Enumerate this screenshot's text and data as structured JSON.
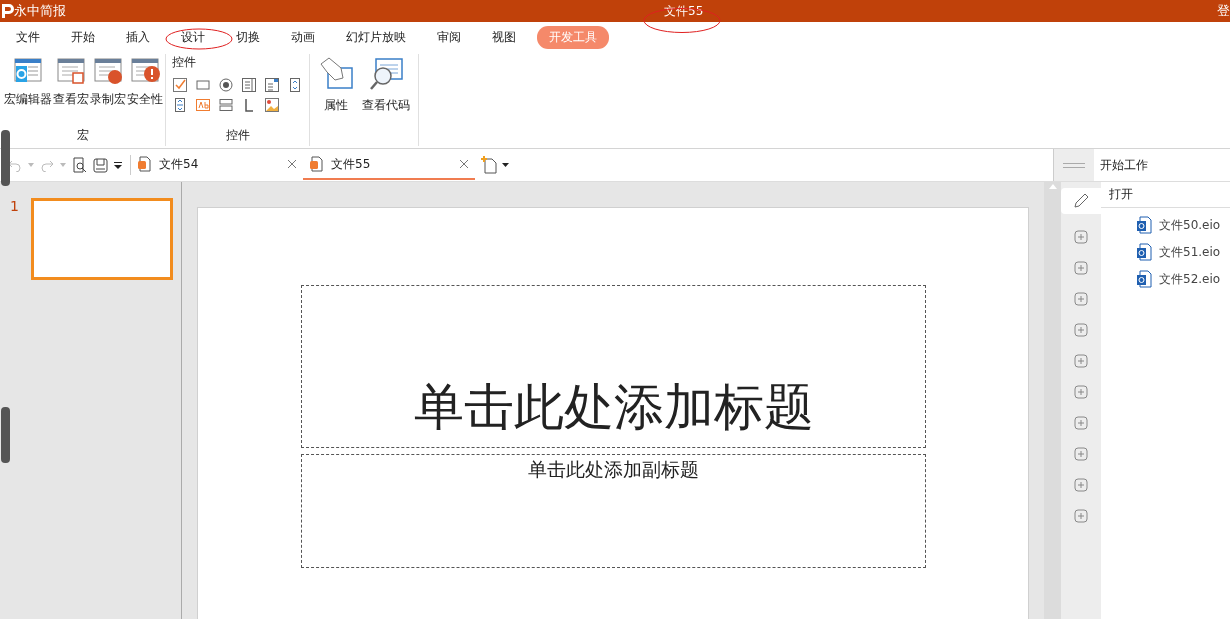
{
  "window": {
    "app_name": "永中简报",
    "title": "文件55",
    "account": "登"
  },
  "menu_tabs": [
    {
      "label": "文件",
      "selected": false
    },
    {
      "label": "开始",
      "selected": false
    },
    {
      "label": "插入",
      "selected": false
    },
    {
      "label": "设计",
      "selected": false
    },
    {
      "label": "切换",
      "selected": false
    },
    {
      "label": "动画",
      "selected": false
    },
    {
      "label": "幻灯片放映",
      "selected": false
    },
    {
      "label": "审阅",
      "selected": false
    },
    {
      "label": "视图",
      "selected": false
    },
    {
      "label": "开发工具",
      "selected": true
    }
  ],
  "ribbon": {
    "macro_group": {
      "label": "宏",
      "buttons": [
        {
          "label": "宏编辑器",
          "kind": "editor"
        },
        {
          "label": "查看宏",
          "kind": "view"
        },
        {
          "label": "录制宏",
          "kind": "record"
        },
        {
          "label": "安全性",
          "kind": "security"
        }
      ]
    },
    "controls_group": {
      "title": "控件",
      "label": "控件"
    },
    "code_group": {
      "buttons": [
        {
          "label": "属性",
          "kind": "properties"
        },
        {
          "label": "查看代码",
          "kind": "code"
        }
      ]
    }
  },
  "doc_tabs": [
    {
      "label": "文件54",
      "selected": false
    },
    {
      "label": "文件55",
      "selected": true
    }
  ],
  "slides": [
    {
      "number": "1",
      "selected": true
    }
  ],
  "slide": {
    "title_placeholder": "单击此处添加标题",
    "subtitle_placeholder": "单击此处添加副标题"
  },
  "task_pane": {
    "title": "开始工作",
    "section": "打开",
    "files": [
      "文件50.eio",
      "文件51.eio",
      "文件52.eio"
    ]
  }
}
